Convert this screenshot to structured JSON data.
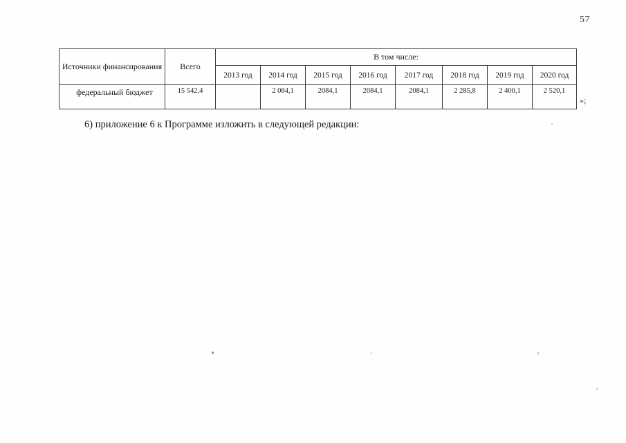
{
  "document": {
    "page_number": "57",
    "closing_mark": "»;",
    "body_paragraph": "6) приложение 6 к Программе изложить в следующей редакции:"
  },
  "table": {
    "headers": {
      "sources": "Источники финансирования",
      "total": "Всего",
      "inclusive": "В том числе:",
      "years": [
        "2013 год",
        "2014 год",
        "2015 год",
        "2016 год",
        "2017 год",
        "2018 год",
        "2019 год",
        "2020 год"
      ]
    },
    "rows": [
      {
        "label": "федеральный бюджет",
        "total": "15 542,4",
        "values": [
          "",
          "2 084,1",
          "2084,1",
          "2084,1",
          "2084,1",
          "2 285,8",
          "2 400,1",
          "2 520,1"
        ]
      }
    ]
  }
}
